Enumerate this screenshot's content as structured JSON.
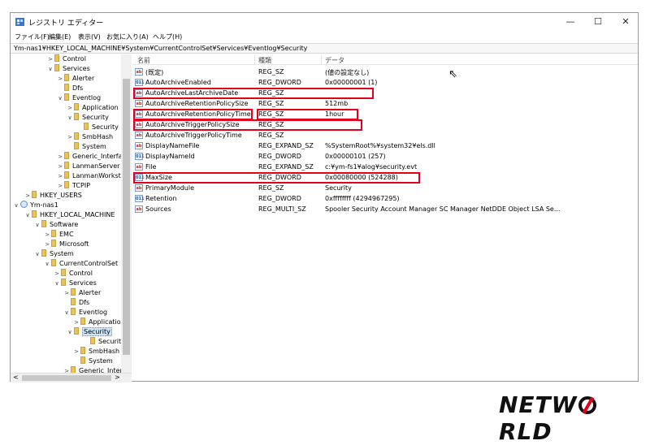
{
  "window": {
    "title": "レジストリ エディター",
    "controls": {
      "minimize": "—",
      "maximize": "☐",
      "close": "✕"
    }
  },
  "menu": [
    "ファイル(F)",
    "編集(E)",
    "表示(V)",
    "お気に入り(A)",
    "ヘルプ(H)"
  ],
  "address": "Ym-nas1¥HKEY_LOCAL_MACHINE¥System¥CurrentControlSet¥Services¥Eventlog¥Security",
  "tree": [
    {
      "label": "Control",
      "expander": ">"
    },
    {
      "label": "Services",
      "expander": "∨"
    },
    {
      "label": "Alerter",
      "expander": ">"
    },
    {
      "label": "Dfs",
      "expander": ""
    },
    {
      "label": "Eventlog",
      "expander": "∨"
    },
    {
      "label": "Application",
      "expander": ">"
    },
    {
      "label": "Security",
      "expander": "∨"
    },
    {
      "label": "Security",
      "expander": ""
    },
    {
      "label": "SmbHash",
      "expander": ">"
    },
    {
      "label": "System",
      "expander": ""
    },
    {
      "label": "Generic_Interfa",
      "expander": ">"
    },
    {
      "label": "LanmanServer",
      "expander": ">"
    },
    {
      "label": "LanmanWorkst",
      "expander": ">"
    },
    {
      "label": "TCPIP",
      "expander": ">"
    },
    {
      "label": "HKEY_USERS",
      "expander": ">"
    },
    {
      "label": "Ym-nas1",
      "expander": "∨"
    },
    {
      "label": "HKEY_LOCAL_MACHINE",
      "expander": "∨"
    },
    {
      "label": "Software",
      "expander": "∨"
    },
    {
      "label": "EMC",
      "expander": ">"
    },
    {
      "label": "Microsoft",
      "expander": ">"
    },
    {
      "label": "System",
      "expander": "∨"
    },
    {
      "label": "CurrentControlSet",
      "expander": "∨"
    },
    {
      "label": "Control",
      "expander": ">"
    },
    {
      "label": "Services",
      "expander": "∨"
    },
    {
      "label": "Alerter",
      "expander": ">"
    },
    {
      "label": "Dfs",
      "expander": ""
    },
    {
      "label": "Eventlog",
      "expander": "∨"
    },
    {
      "label": "Application",
      "expander": ">"
    },
    {
      "label": "Security",
      "expander": "∨"
    },
    {
      "label": "Security",
      "expander": ""
    },
    {
      "label": "SmbHash",
      "expander": ">"
    },
    {
      "label": "System",
      "expander": ""
    },
    {
      "label": "Generic_Interfa",
      "expander": ">"
    }
  ],
  "tree_scroll": {
    "left": "<",
    "right": ">"
  },
  "columns": {
    "name": "名前",
    "type": "種類",
    "data": "データ"
  },
  "rows": [
    {
      "name": "(既定)",
      "type": "REG_SZ",
      "data": "(値の設定なし)",
      "icon": "ab"
    },
    {
      "name": "AutoArchiveEnabled",
      "type": "REG_DWORD",
      "data": "0x00000001 (1)",
      "icon": "bin"
    },
    {
      "name": "AutoArchiveLastArchiveDate",
      "type": "REG_SZ",
      "data": "",
      "icon": "ab"
    },
    {
      "name": "AutoArchiveRetentionPolicySize",
      "type": "REG_SZ",
      "data": "512mb",
      "icon": "ab"
    },
    {
      "name": "AutoArchiveRetentionPolicyTime",
      "type": "REG_SZ",
      "data": "1hour",
      "icon": "ab"
    },
    {
      "name": "AutoArchiveTriggerPolicySize",
      "type": "REG_SZ",
      "data": "",
      "icon": "ab"
    },
    {
      "name": "AutoArchiveTriggerPolicyTime",
      "type": "REG_SZ",
      "data": "",
      "icon": "ab"
    },
    {
      "name": "DisplayNameFile",
      "type": "REG_EXPAND_SZ",
      "data": "%SystemRoot%¥system32¥els.dll",
      "icon": "ab"
    },
    {
      "name": "DisplayNameId",
      "type": "REG_DWORD",
      "data": "0x00000101 (257)",
      "icon": "bin"
    },
    {
      "name": "File",
      "type": "REG_EXPAND_SZ",
      "data": "c:¥ym-fs1¥alog¥security.evt",
      "icon": "ab"
    },
    {
      "name": "MaxSize",
      "type": "REG_DWORD",
      "data": "0x00080000 (524288)",
      "icon": "bin"
    },
    {
      "name": "PrimaryModule",
      "type": "REG_SZ",
      "data": "Security",
      "icon": "ab"
    },
    {
      "name": "Retention",
      "type": "REG_DWORD",
      "data": "0xffffffff (4294967295)",
      "icon": "bin"
    },
    {
      "name": "Sources",
      "type": "REG_MULTI_SZ",
      "data": "Spooler Security Account Manager SC Manager NetDDE Object LSA Se...",
      "icon": "ab"
    }
  ],
  "icon_text": {
    "ab": "ab",
    "bin": "011"
  },
  "logo": {
    "part1": "NETW",
    "part2": "RLD"
  },
  "colors": {
    "highlight": "#e2001a",
    "selection": "#cce4f7",
    "folder": "#e9c25a"
  }
}
